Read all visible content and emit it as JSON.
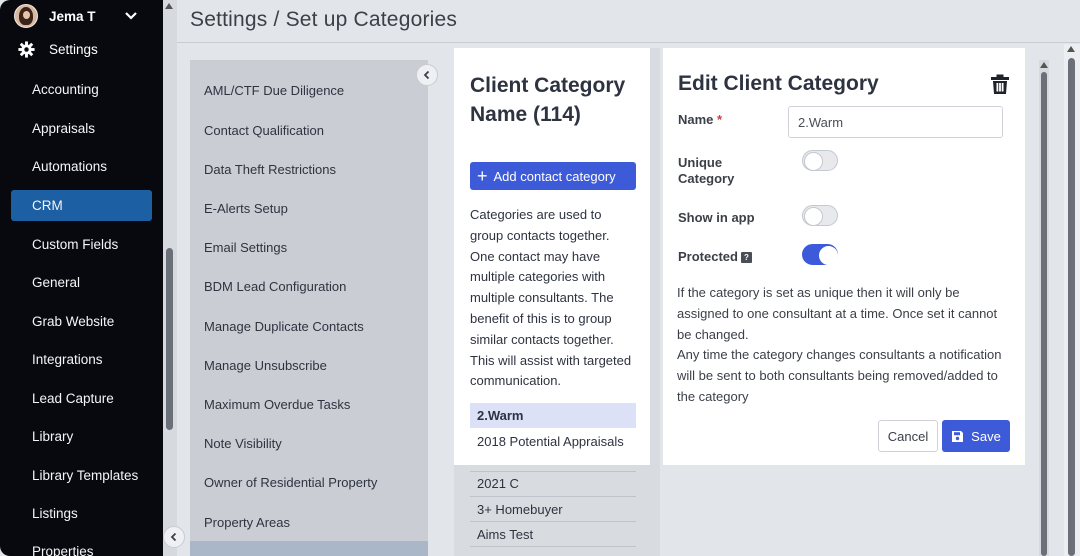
{
  "user": {
    "name": "Jema T"
  },
  "sidebar": {
    "settings_label": "Settings",
    "items": [
      {
        "label": "Accounting"
      },
      {
        "label": "Appraisals"
      },
      {
        "label": "Automations"
      },
      {
        "label": "CRM",
        "active": true
      },
      {
        "label": "Custom Fields"
      },
      {
        "label": "General"
      },
      {
        "label": "Grab Website"
      },
      {
        "label": "Integrations"
      },
      {
        "label": "Lead Capture"
      },
      {
        "label": "Library"
      },
      {
        "label": "Library Templates"
      },
      {
        "label": "Listings"
      },
      {
        "label": "Properties"
      }
    ]
  },
  "header": {
    "title": "Settings / Set up Categories"
  },
  "menu": {
    "items": [
      {
        "label": "AML/CTF Due Diligence"
      },
      {
        "label": "Contact Qualification"
      },
      {
        "label": "Data Theft Restrictions"
      },
      {
        "label": "E-Alerts Setup"
      },
      {
        "label": "Email Settings"
      },
      {
        "label": "BDM Lead Configuration"
      },
      {
        "label": "Manage Duplicate Contacts"
      },
      {
        "label": "Manage Unsubscribe"
      },
      {
        "label": "Maximum Overdue Tasks"
      },
      {
        "label": "Note Visibility"
      },
      {
        "label": "Owner of Residential Property"
      },
      {
        "label": "Property Areas"
      }
    ]
  },
  "categories": {
    "title": "Client Category Name (114)",
    "add_button": "Add contact category",
    "description": "Categories are used to group contacts together. One contact may have multiple categories with multiple consultants. The benefit of this is to group similar contacts together. This will assist with targeted communication.",
    "selected": "2.Warm",
    "items": [
      {
        "label": "2018 Potential Appraisals"
      },
      {
        "label": "2021 C"
      },
      {
        "label": "3+ Homebuyer"
      },
      {
        "label": "Aims Test"
      }
    ]
  },
  "edit": {
    "title": "Edit Client Category",
    "name_label": "Name",
    "name_required": "*",
    "name_value": "2.Warm",
    "unique_label": "Unique Category",
    "unique_on": false,
    "show_in_app_label": "Show in app",
    "show_in_app_on": false,
    "protected_label": "Protected",
    "protected_on": true,
    "info_line1": "If the category is set as unique then it will only be assigned to one consultant at a time. Once set it cannot be changed.",
    "info_line2": "Any time the category changes consultants a notification will be sent to both consultants being removed/added to the category",
    "cancel_label": "Cancel",
    "save_label": "Save"
  },
  "colors": {
    "sidebar_bg": "#07090f",
    "active_nav": "#1d5fa3",
    "primary": "#3d5bd9",
    "required": "#d23b3b"
  }
}
